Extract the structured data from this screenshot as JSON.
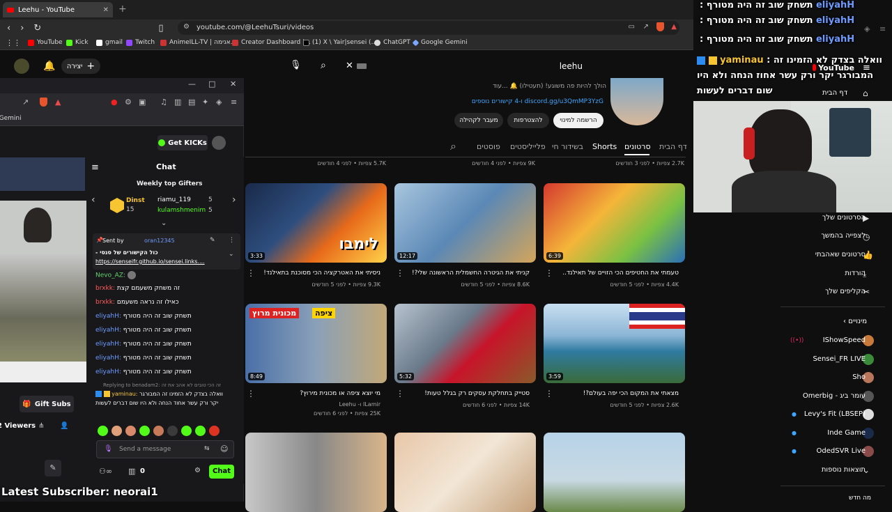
{
  "browser": {
    "tab_title": "Leehu - YouTube",
    "url": "youtube.com/@LeehuTsuri/videos",
    "bookmarks": [
      "YouTube",
      "Kick",
      "gmail",
      "Twitch",
      "AnimeILL-TV | אנימה...",
      "Creator Dashboard |...",
      "(1) X \\ Yair|sensei (...",
      "ChatGPT",
      "Google Gemini"
    ]
  },
  "yt_header": {
    "search_value": "leehu",
    "create_label": "יצירה"
  },
  "channel": {
    "desc_line": "הולך להיות פה משוגע! (תעטילו) 🔔 ...עוד",
    "links_line": "discord.gg/u3QmMP3YzG ו-4 קישורים נוספים",
    "subscribe_label": "הרשמה למינוי",
    "join_label": "להצטרפות",
    "community_label": "מעבר לקהילה",
    "tabs": [
      "דף הבית",
      "סרטונים",
      "Shorts",
      "בשידור חי",
      "פלייליסטים",
      "פוסטים"
    ],
    "prev_meta": [
      "2.7K צפיות • לפני 3 חודשים",
      "9K צפיות • לפני 4 חודשים",
      "5.7K צפיות • לפני 4 חודשים"
    ]
  },
  "videos": [
    {
      "title": "טעמתי את החטיפים הכי הזויים של תאילנד..",
      "meta": "4.4K צפיות • לפני 5 חודשים",
      "duration": "6:39"
    },
    {
      "title": "קניתי את הגיטרה החשמלית הראשונה שלי?!",
      "meta": "8.6K צפיות • לפני 5 חודשים",
      "duration": "12:17"
    },
    {
      "title": "ניסיתי את האטרקציה הכי מסוכנת בתאילנד!",
      "meta": "9.3K צפיות • לפני 5 חודשים",
      "duration": "3:33",
      "overlay": "לימבו"
    },
    {
      "title": "מצאתי את המקום הכי יפה בעולם?!",
      "meta": "2.6K צפיות • לפני 5 חודשים",
      "duration": "3:59"
    },
    {
      "title": "סטייק בתחלקת עסקים רק בגלל טעות!",
      "meta": "14K צפיות • לפני 6 חודשים",
      "duration": "5:32"
    },
    {
      "title": "מי יוצא ציפה או מכונית מירוץ?",
      "author": "ILamir ו- Leehu",
      "meta": "25K צפיות • לפני 6 חודשים",
      "duration": "8:49",
      "overlay1": "מכונית מרוץ",
      "overlay2": "ציפה"
    }
  ],
  "kick": {
    "get_kicks": "Get KICKs",
    "chat_title": "Chat",
    "gifters_title": "Weekly top Gifters",
    "gifters": [
      {
        "name": "Dinst",
        "count": "15"
      },
      {
        "name": "riamu_119",
        "count": "5"
      },
      {
        "name": "kulamshmenim",
        "count": "5"
      }
    ],
    "pinned_by_label": "Sent by",
    "pinned_by": "oran12345",
    "pinned_text": "כול הקישורים של סנסי -",
    "pinned_link": "https://senseifr.github.io/sensei.links....",
    "messages": [
      {
        "user": "Nevo_AZ:",
        "text": "",
        "color": "#62d26f"
      },
      {
        "user": "brxkk:",
        "text": "זה משחק משעמם קצת",
        "color": "#ff5c5c"
      },
      {
        "user": "brxkk:",
        "text": "כאילו זה נראה משעמם",
        "color": "#ff5c5c"
      },
      {
        "user": "eliyahH:",
        "text": "תשחק שוב זה היה מטורף",
        "color": "#6d9bff"
      },
      {
        "user": "eliyahH:",
        "text": "תשחק שוב זה היה מטורף",
        "color": "#6d9bff"
      },
      {
        "user": "eliyahH:",
        "text": "תשחק שוב זה היה מטורף",
        "color": "#6d9bff"
      },
      {
        "user": "eliyahH:",
        "text": "תשחק שוב זה היה מטורף",
        "color": "#6d9bff"
      },
      {
        "user": "eliyahH:",
        "text": "תשחק שוב זה היה מטורף",
        "color": "#6d9bff"
      }
    ],
    "reply_line": "Replying to benadam2: זה הכי טובים לא אהב את זה",
    "last_user": "yaminau:",
    "last_text": "וואלה בצדק לא הזמינו זה המבורגר יקר ורק עשר אחוד הנחה ולא היו שום דברים לעשות",
    "input_placeholder": "Send a message",
    "chat_button": "Chat",
    "count_zero": "0",
    "gift_subs": "Gift Subs",
    "viewers_label": "Viewers"
  },
  "overlay": {
    "latest_sub_label": "Latest Subscriber:",
    "latest_sub": "neorai1",
    "stream_chat": [
      {
        "user": "eliyahH",
        "text": "תשחק שוב זה היה מטורף :"
      },
      {
        "user": "eliyahH",
        "text": "תשחק שוב זה היה מטורף :"
      },
      {
        "user": "eliyahH",
        "text": "תשחק שוב זה היה מטורף :"
      }
    ],
    "big_msg_user": "yaminau",
    "big_msg": "וואלה בצדק לא הזמינו זה : המבורגר יקר ורק עשר אחוז הנחה ולא היו שום דברים לעשות"
  },
  "sidebar": {
    "home": "דף הבית",
    "items": [
      "הסרטונים שלך",
      "לצפייה בהמשך",
      "סרטונים שאהבתי",
      "הורדות",
      "הקליפים שלך"
    ],
    "subs_title": "מינויים",
    "subs": [
      "IShowSpeed",
      "Sensei_FR LIVE",
      "Sho",
      "עומר ביג - Omerbig",
      "Levy's Fit (LBSEP)",
      "Inde Game",
      "OdedSVR Live"
    ],
    "more": "תוצאות נוספות",
    "bottom": "מה חדש"
  },
  "colors": {
    "kick_green": "#53fc18",
    "yt_red": "#ff0000"
  }
}
